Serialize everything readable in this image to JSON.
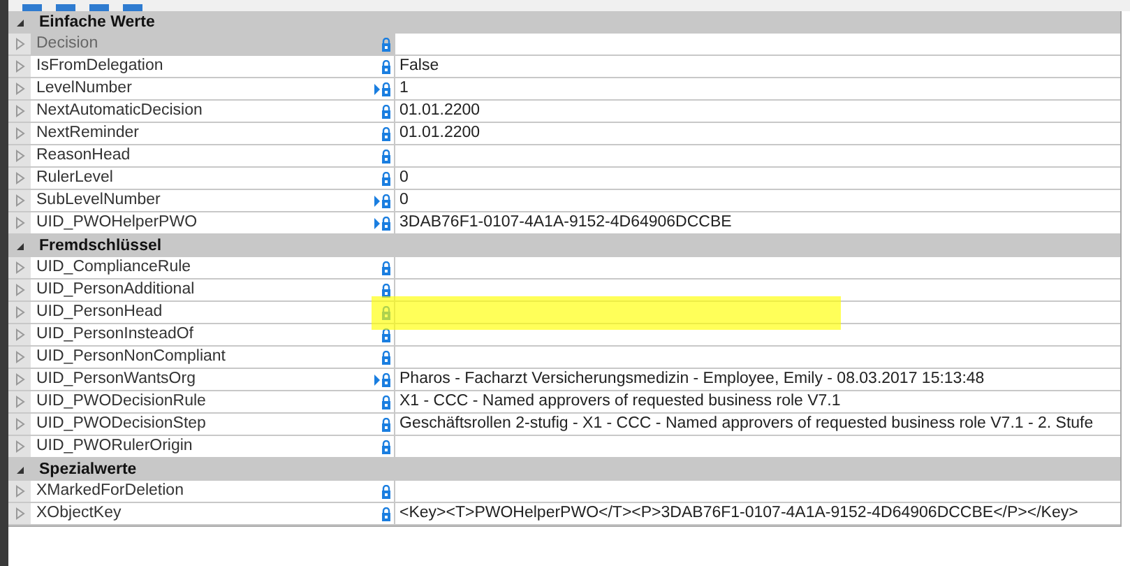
{
  "sections": [
    {
      "title": "Einfache Werte",
      "expanded": true,
      "rows": [
        {
          "name": "Decision",
          "disabled": true,
          "linked": false,
          "highlighted": false
        },
        {
          "name": "IsFromDelegation",
          "value": "False",
          "disabled": false,
          "linked": false,
          "highlighted": false
        },
        {
          "name": "LevelNumber",
          "value": "1",
          "disabled": false,
          "linked": true,
          "highlighted": false
        },
        {
          "name": "NextAutomaticDecision",
          "value": "01.01.2200",
          "disabled": false,
          "linked": false,
          "highlighted": false
        },
        {
          "name": "NextReminder",
          "value": "01.01.2200",
          "disabled": false,
          "linked": false,
          "highlighted": false
        },
        {
          "name": "ReasonHead",
          "disabled": false,
          "linked": false,
          "highlighted": false
        },
        {
          "name": "RulerLevel",
          "value": "0",
          "disabled": false,
          "linked": false,
          "highlighted": false
        },
        {
          "name": "SubLevelNumber",
          "value": "0",
          "disabled": false,
          "linked": true,
          "highlighted": false
        },
        {
          "name": "UID_PWOHelperPWO",
          "value": "3DAB76F1-0107-4A1A-9152-4D64906DCCBE",
          "disabled": false,
          "linked": true,
          "highlighted": false
        }
      ]
    },
    {
      "title": "Fremdschlüssel",
      "expanded": true,
      "rows": [
        {
          "name": "UID_ComplianceRule",
          "disabled": false,
          "linked": false,
          "highlighted": false
        },
        {
          "name": "UID_PersonAdditional",
          "disabled": false,
          "linked": false,
          "highlighted": false
        },
        {
          "name": "UID_PersonHead",
          "disabled": false,
          "linked": false,
          "highlighted": true
        },
        {
          "name": "UID_PersonInsteadOf",
          "disabled": false,
          "linked": false,
          "highlighted": false
        },
        {
          "name": "UID_PersonNonCompliant",
          "disabled": false,
          "linked": false,
          "highlighted": false
        },
        {
          "name": "UID_PersonWantsOrg",
          "value": "Pharos - Facharzt Versicherungsmedizin - Employee, Emily - 08.03.2017 15:13:48",
          "disabled": false,
          "linked": true,
          "highlighted": false
        },
        {
          "name": "UID_PWODecisionRule",
          "value": "X1 - CCC - Named approvers of requested business role V7.1",
          "disabled": false,
          "linked": false,
          "highlighted": false
        },
        {
          "name": "UID_PWODecisionStep",
          "value": "Geschäftsrollen 2-stufig - X1 - CCC - Named approvers of requested business role V7.1 - 2. Stufe",
          "disabled": false,
          "linked": false,
          "highlighted": false
        },
        {
          "name": "UID_PWORulerOrigin",
          "disabled": false,
          "linked": false,
          "highlighted": false
        }
      ]
    },
    {
      "title": "Spezialwerte",
      "expanded": true,
      "rows": [
        {
          "name": "XMarkedForDeletion",
          "disabled": false,
          "linked": false,
          "highlighted": false
        },
        {
          "name": "XObjectKey",
          "value": "<Key><T>PWOHelperPWO</T><P>3DAB76F1-0107-4A1A-9152-4D64906DCCBE</P></Key>",
          "disabled": false,
          "linked": false,
          "highlighted": false
        }
      ]
    }
  ]
}
